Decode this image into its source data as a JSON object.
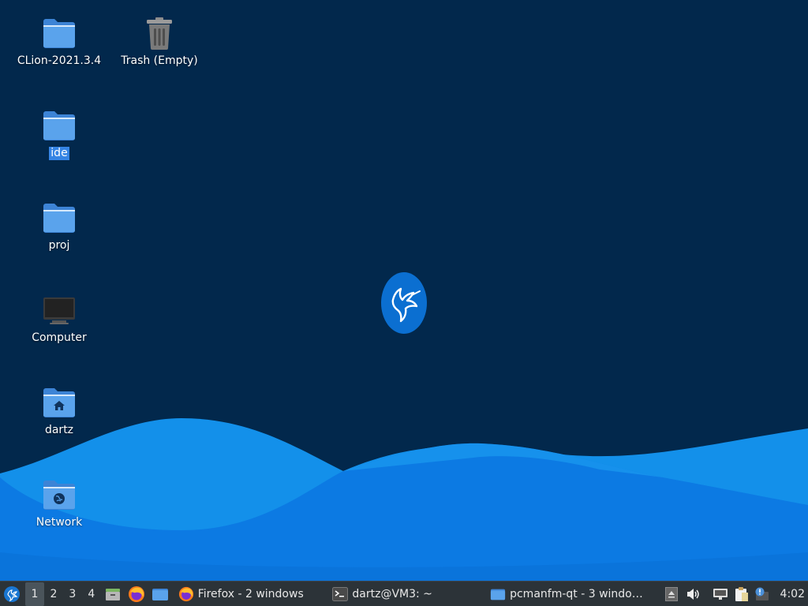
{
  "desktop": {
    "icons": [
      {
        "label": "CLion-2021.3.4",
        "icon": "folder-icon"
      },
      {
        "label": "Trash (Empty)",
        "icon": "trash-icon"
      },
      {
        "label": "ide",
        "icon": "folder-icon",
        "selected": true
      },
      {
        "label": "proj",
        "icon": "folder-icon"
      },
      {
        "label": "Computer",
        "icon": "computer-icon"
      },
      {
        "label": "dartz",
        "icon": "home-folder-icon"
      },
      {
        "label": "Network",
        "icon": "network-folder-icon"
      }
    ],
    "logo": "lubuntu-logo",
    "colors": {
      "background": "#02284c",
      "wave_light": "#1e9bf0",
      "wave_dark": "#0a6fd6",
      "accent": "#3584e4"
    }
  },
  "taskbar": {
    "start_menu": "lubuntu-menu-icon",
    "desktops": [
      "1",
      "2",
      "3",
      "4"
    ],
    "active_desktop": "1",
    "quicklaunch": [
      "show-desktop-icon",
      "firefox-icon",
      "file-manager-icon"
    ],
    "tasks": [
      {
        "title": "Firefox - 2 windows",
        "icon": "firefox-icon"
      },
      {
        "title": "dartz@VM3: ~",
        "icon": "terminal-icon"
      },
      {
        "title": "pcmanfm-qt - 3 windo…",
        "icon": "folder-icon"
      }
    ],
    "tray": [
      "eject-icon",
      "volume-icon",
      "network-icon",
      "clipboard-icon",
      "update-notifier-icon"
    ],
    "clock": "4:02"
  }
}
